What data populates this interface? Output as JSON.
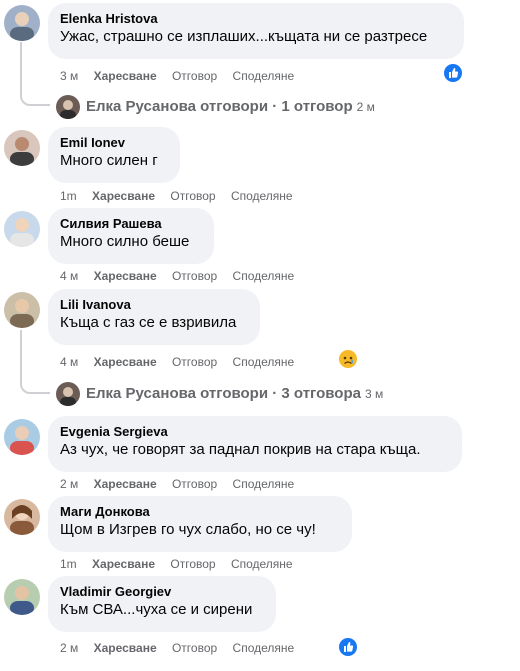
{
  "actions": {
    "like": "Харесване",
    "reply": "Отговор",
    "share": "Споделяне"
  },
  "comments": [
    {
      "name": "Elenka Hristova",
      "text": "Ужас, страшно се изплаших...къщата ни се разтресе",
      "time": "3 м",
      "reaction": "like-icon"
    },
    {
      "name": "Emil Ionev",
      "text": "Много силен г",
      "time": "1m"
    },
    {
      "name": "Силвия Рашева",
      "text": "Много силно беше",
      "time": "4 м"
    },
    {
      "name": "Lili Ivanova",
      "text": "Къща с газ се е взривила",
      "time": "4 м",
      "reaction": "sad-icon"
    },
    {
      "name": "Evgenia Sergieva",
      "text": "Аз чух, че говорят за паднал покрив на стара къща.",
      "time": "2 м"
    },
    {
      "name": "Маги Донкова",
      "text": "Щом в Изгрев го чух слабо, но се чу!",
      "time": "1m"
    },
    {
      "name": "Vladimir Georgiev",
      "text": "Към СВА...чуха се и сирени",
      "time": "2 м",
      "reaction": "like-icon"
    }
  ],
  "replies": [
    {
      "text": "Елка Русанова отговори · 1 отговор",
      "time": "2 м"
    },
    {
      "text": "Елка Русанова отговори · 3 отговора",
      "time": "3 м"
    }
  ],
  "colors": {
    "bubble": "#f0f2f5",
    "meta": "#65676b",
    "like_blue": "#1877f2"
  }
}
